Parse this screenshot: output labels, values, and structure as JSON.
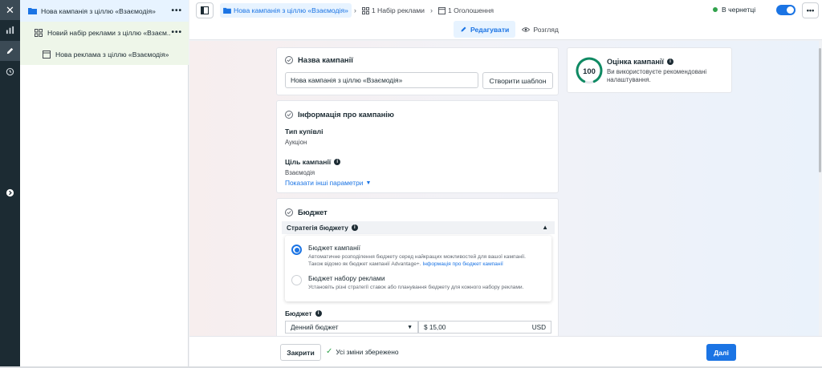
{
  "tree": {
    "campaign": "Нова кампанія з ціллю «Взаємодія»",
    "adset": "Новий набір реклами з ціллю «Взаєм...",
    "ad": "Нова реклама з ціллю «Взаємодія»",
    "more": "•••"
  },
  "header": {
    "crumb_campaign": "Нова кампанія з ціллю «Взаємодія»",
    "crumb_adset": "1 Набір реклами",
    "crumb_ad": "1 Оголошення",
    "status": "В чернетці",
    "more": "•••",
    "tab_edit": "Редагувати",
    "tab_view": "Розгляд"
  },
  "campaign_name": {
    "title": "Назва кампанії",
    "value": "Нова кампанія з ціллю «Взаємодія»",
    "template_button": "Створити шаблон"
  },
  "info": {
    "title": "Інформація про кампанію",
    "buy_type_label": "Тип купівлі",
    "buy_type_value": "Аукціон",
    "goal_label": "Ціль кампанії",
    "goal_value": "Взаємодія",
    "show_more": "Показати інші параметри"
  },
  "budget": {
    "title": "Бюджет",
    "strategy_label": "Стратегія бюджету",
    "option1_title": "Бюджет кампанії",
    "option1_desc": "Автоматичне розподілення бюджету серед найкращих можливостей для вашої кампанії.",
    "option1_desc2": "Також відомо як бюджет кампанії Advantage+.",
    "option1_link": "Інформація про бюджет кампанії",
    "option2_title": "Бюджет набору реклами",
    "option2_desc": "Установіть різні стратегії ставок або планування бюджету для кожного набору реклами.",
    "budget_label": "Бюджет",
    "budget_type": "Денний бюджет",
    "amount": "$ 15,00",
    "currency": "USD"
  },
  "score": {
    "value": "100",
    "progress": 1.0,
    "title": "Оцінка кампанії",
    "desc": "Ви використовуєте рекомендовані налаштування."
  },
  "footer": {
    "close": "Закрити",
    "saved": "Усі зміни збережено",
    "next": "Далі"
  },
  "colors": {
    "accent": "#1b74e4",
    "success": "#31a24c",
    "score_ring": "#0f8a63",
    "rail": "#1c2b33"
  }
}
